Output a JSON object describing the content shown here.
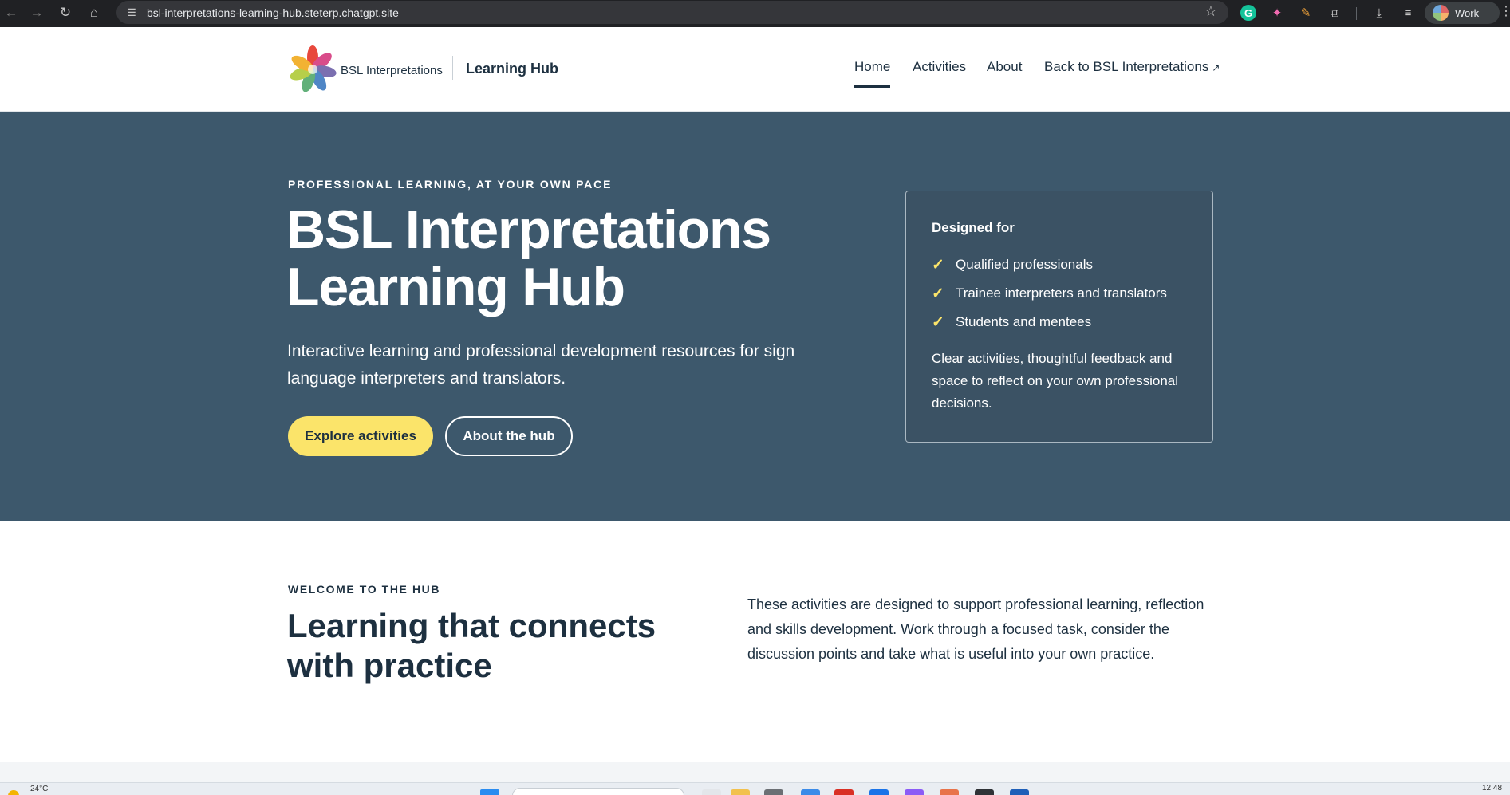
{
  "browser": {
    "url": "bsl-interpretations-learning-hub.steterp.chatgpt.site",
    "profile_label": "Work",
    "icons": [
      "back-icon",
      "forward-icon",
      "reload-icon",
      "home-icon",
      "site-info-icon",
      "star-icon",
      "grammarly-icon",
      "extension-icon",
      "downloads-icon",
      "menu-icon"
    ]
  },
  "header": {
    "logo_text": "BSL Interpretations",
    "hub_name": "Learning Hub",
    "nav": [
      {
        "label": "Home",
        "active": true
      },
      {
        "label": "Activities",
        "active": false
      },
      {
        "label": "About",
        "active": false
      },
      {
        "label": "Back to BSL Interpretations",
        "external_icon": "↗"
      }
    ]
  },
  "hero": {
    "eyebrow": "PROFESSIONAL LEARNING, AT YOUR OWN PACE",
    "title": "BSL Interpretations Learning Hub",
    "lead": "Interactive learning and professional development resources for sign language interpreters and translators.",
    "primary_button": "Explore activities",
    "secondary_button": "About the hub",
    "card": {
      "title": "Designed for",
      "items": [
        "Qualified professionals",
        "Trainee interpreters and translators",
        "Students and mentees"
      ],
      "check_glyph": "✓",
      "text": "Clear activities, thoughtful feedback and space to reflect on your own professional decisions."
    }
  },
  "welcome": {
    "eyebrow": "WELCOME TO THE HUB",
    "heading": "Learning that connects with practice",
    "text": "These activities are designed to support professional learning, reflection and skills development. Work through a focused task, consider the discussion points and take what is useful into your own practice."
  },
  "taskbar": {
    "temperature": "24°C",
    "clock": "12:48"
  },
  "colors": {
    "hero_bg": "#3d586c",
    "accent_yellow": "#fbe46a",
    "text_dark": "#1d3040"
  }
}
